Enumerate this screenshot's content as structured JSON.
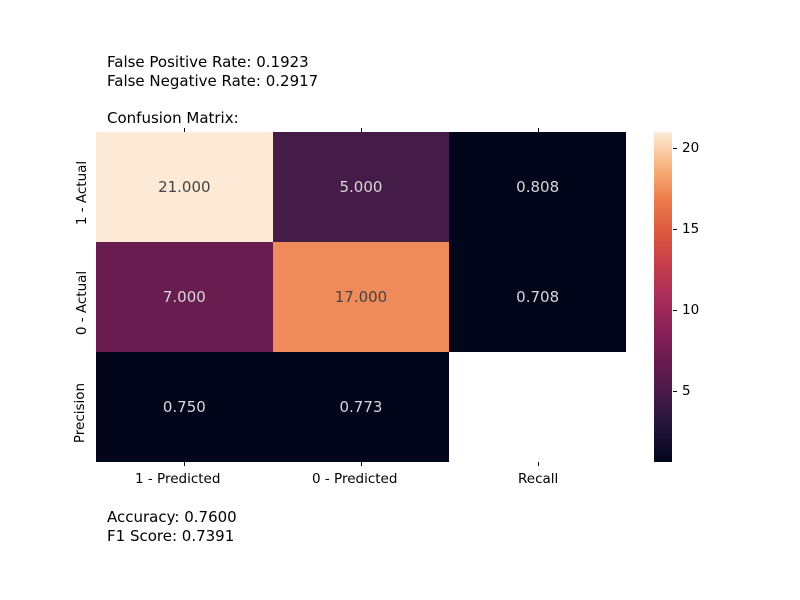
{
  "header": {
    "line1": "False Positive Rate: 0.1923",
    "line2": "False Negative Rate: 0.2917"
  },
  "title": "Confusion Matrix:",
  "footer": {
    "line1": "Accuracy: 0.7600",
    "line2": "F1 Score: 0.7391"
  },
  "y_labels": [
    "1 - Actual",
    "0 - Actual",
    "Precision"
  ],
  "x_labels": [
    "1 - Predicted",
    "0 - Predicted",
    "Recall"
  ],
  "cells": {
    "r0c0": {
      "text": "21.000",
      "bg": "#fce9d6",
      "fg": "#444444"
    },
    "r0c1": {
      "text": "5.000",
      "bg": "#451b47",
      "fg": "#d8d8d8"
    },
    "r0c2": {
      "text": "0.808",
      "bg": "#03051a",
      "fg": "#d8d8d8"
    },
    "r1c0": {
      "text": "7.000",
      "bg": "#691c50",
      "fg": "#d8d8d8"
    },
    "r1c1": {
      "text": "17.000",
      "bg": "#ef8b5a",
      "fg": "#444444"
    },
    "r1c2": {
      "text": "0.708",
      "bg": "#03051a",
      "fg": "#d8d8d8"
    },
    "r2c0": {
      "text": "0.750",
      "bg": "#03051a",
      "fg": "#d8d8d8"
    },
    "r2c1": {
      "text": "0.773",
      "bg": "#03051a",
      "fg": "#d8d8d8"
    },
    "r2c2": {
      "text": "",
      "bg": "#ffffff",
      "fg": "#ffffff"
    }
  },
  "colorbar": {
    "ticks": [
      {
        "label": "20",
        "value": 20
      },
      {
        "label": "15",
        "value": 15
      },
      {
        "label": "10",
        "value": 10
      },
      {
        "label": "5",
        "value": 5
      }
    ],
    "min": 0.708,
    "max": 21.0
  },
  "chart_data": {
    "type": "heatmap",
    "title": "Confusion Matrix:",
    "row_labels": [
      "1 - Actual",
      "0 - Actual",
      "Precision"
    ],
    "col_labels": [
      "1 - Predicted",
      "0 - Predicted",
      "Recall"
    ],
    "values": [
      [
        21.0,
        5.0,
        0.808
      ],
      [
        7.0,
        17.0,
        0.708
      ],
      [
        0.75,
        0.773,
        null
      ]
    ],
    "colorbar_range": [
      0.708,
      21.0
    ],
    "annotations": {
      "false_positive_rate": 0.1923,
      "false_negative_rate": 0.2917,
      "accuracy": 0.76,
      "f1_score": 0.7391
    }
  }
}
